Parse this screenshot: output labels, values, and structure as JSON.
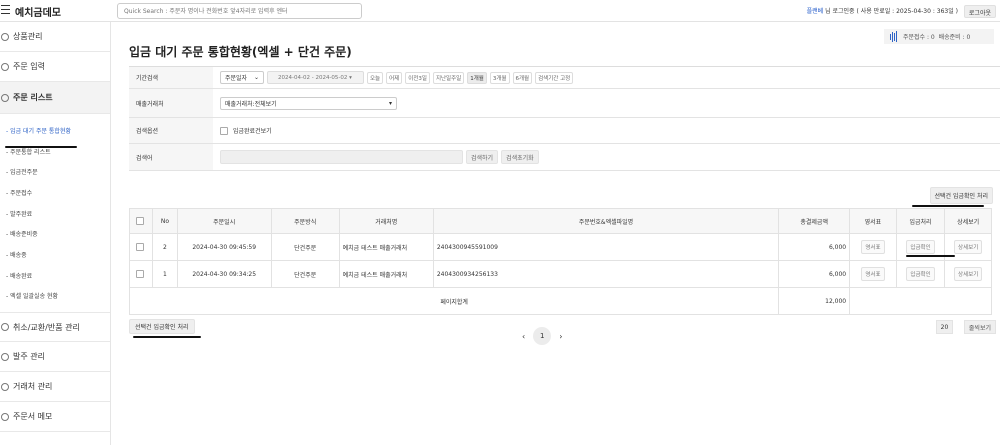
{
  "app": {
    "title": "예치금데모"
  },
  "search": {
    "placeholder": "Quick Search : 주문자 명이나 전화번호 앞4자리로 입력후 엔터"
  },
  "user": {
    "name": "플랜베",
    "suffix": "님 로그인중 ( 사용 만료일 : 2025-04-30 : 363일 )",
    "logout": "로그아웃"
  },
  "sidebar": {
    "items": [
      {
        "label": "상품관리"
      },
      {
        "label": "주문 입력"
      },
      {
        "label": "주문 리스트"
      },
      {
        "label": "취소/교환/반품 관리"
      },
      {
        "label": "발주 관리"
      },
      {
        "label": "거래처 관리"
      },
      {
        "label": "주문서 메모"
      }
    ],
    "sub_items": [
      {
        "label": "- 입금 대기 주문 통합현황"
      },
      {
        "label": "- 주문통합 리스트"
      },
      {
        "label": "- 입금전주문"
      },
      {
        "label": "- 주문접수"
      },
      {
        "label": "- 발주완료"
      },
      {
        "label": "- 배송준비중"
      },
      {
        "label": "- 배송중"
      },
      {
        "label": "- 배송완료"
      },
      {
        "label": "- 엑셀 일괄실송 현황"
      }
    ]
  },
  "status": {
    "orders": "주문접수 : 0",
    "shipping": "배송준비 : 0"
  },
  "page": {
    "title": "입금 대기 주문 통합현황(엑셀 + 단건 주문)"
  },
  "filter": {
    "period_label": "기간검색",
    "date_type": "주문일자",
    "date_range": "2024-04-02 - 2024-05-02",
    "quick_ranges": [
      "오늘",
      "어제",
      "이전3일",
      "지난일주일",
      "1개월",
      "3개월",
      "6개월",
      "검색기간 고정"
    ],
    "vendor_label": "매출거래처",
    "vendor_value": "매출거래처:전체보기",
    "option_label": "검색옵션",
    "option_check": "입금완료건보기",
    "keyword_label": "검색어",
    "search_btn": "검색하기",
    "reset_btn": "검색초기화"
  },
  "actions": {
    "confirm_selected": "선택건 입금확인 처리"
  },
  "table": {
    "headers": [
      "",
      "No",
      "주문일시",
      "주문방식",
      "거래처명",
      "주문번호&엑셀파일명",
      "총결제금액",
      "영서표",
      "입금처리",
      "상세보기"
    ],
    "rows": [
      {
        "no": "2",
        "datetime": "2024-04-30 09:45:59",
        "method": "단건주문",
        "vendor": "예치금 테스트 매출거래처",
        "order_no": "2404300945591009",
        "amount": "6,000",
        "receipt": "영서표",
        "deposit": "입금확인",
        "detail": "상세보기"
      },
      {
        "no": "1",
        "datetime": "2024-04-30 09:34:25",
        "method": "단건주문",
        "vendor": "예치금 테스트 매출거래처",
        "order_no": "2404300934256133",
        "amount": "6,000",
        "receipt": "영서표",
        "deposit": "입금확인",
        "detail": "상세보기"
      }
    ],
    "subtotal_label": "페이지합계",
    "subtotal_value": "12,000"
  },
  "pagination": {
    "prev": "‹",
    "current": "1",
    "next": "›",
    "page_size": "20",
    "view_btn": "줄씩보기"
  }
}
